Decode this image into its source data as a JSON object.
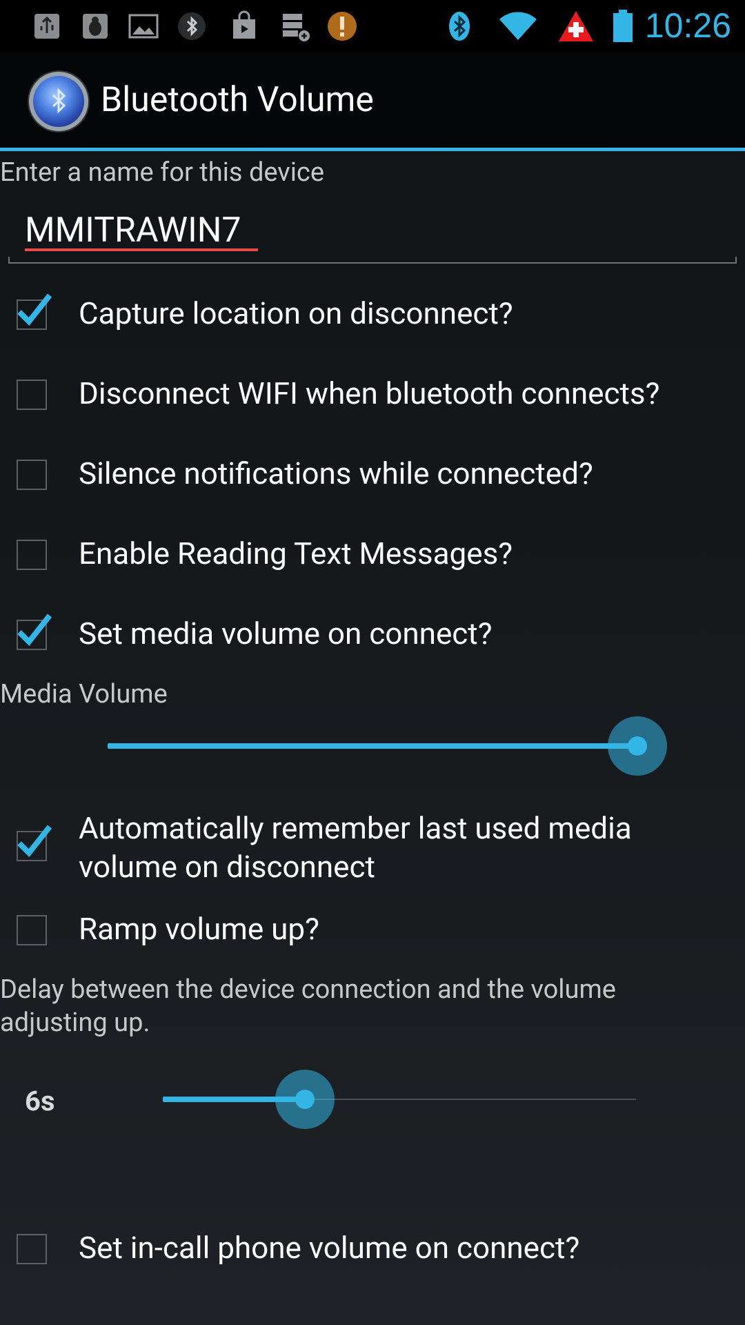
{
  "status_bar": {
    "time": "10:26",
    "left_icons": [
      "usb-icon",
      "bug-icon",
      "image-icon",
      "bluetooth-small-icon",
      "play-store-icon",
      "storage-icon",
      "alert-icon"
    ],
    "right_icons": [
      "bluetooth-icon",
      "wifi-icon",
      "swiss-flag-icon",
      "battery-icon"
    ],
    "accent_color": "#33b5e5"
  },
  "action_bar": {
    "title": "Bluetooth Volume",
    "icon": "bluetooth-app-icon"
  },
  "device_name": {
    "label": "Enter a name for this device",
    "value": "MMITRAWIN7"
  },
  "options": [
    {
      "label": "Capture location on disconnect?",
      "checked": true
    },
    {
      "label": "Disconnect WIFI when bluetooth connects?",
      "checked": false
    },
    {
      "label": "Silence notifications while connected?",
      "checked": false
    },
    {
      "label": "Enable Reading Text Messages?",
      "checked": false
    },
    {
      "label": "Set media volume on connect?",
      "checked": true
    }
  ],
  "media_volume": {
    "label": "Media Volume",
    "level": 1.0
  },
  "remember_option": {
    "line1": "Automatically remember last used media",
    "line2": "volume on disconnect",
    "checked": true
  },
  "ramp_option": {
    "label": "Ramp volume up?",
    "checked": false
  },
  "delay": {
    "line1": "Delay between the device connection and the volume",
    "line2": "adjusting up.",
    "value_text": "6s",
    "level": 0.3
  },
  "incall_option": {
    "label": "Set in-call phone volume on connect?",
    "checked": false
  }
}
